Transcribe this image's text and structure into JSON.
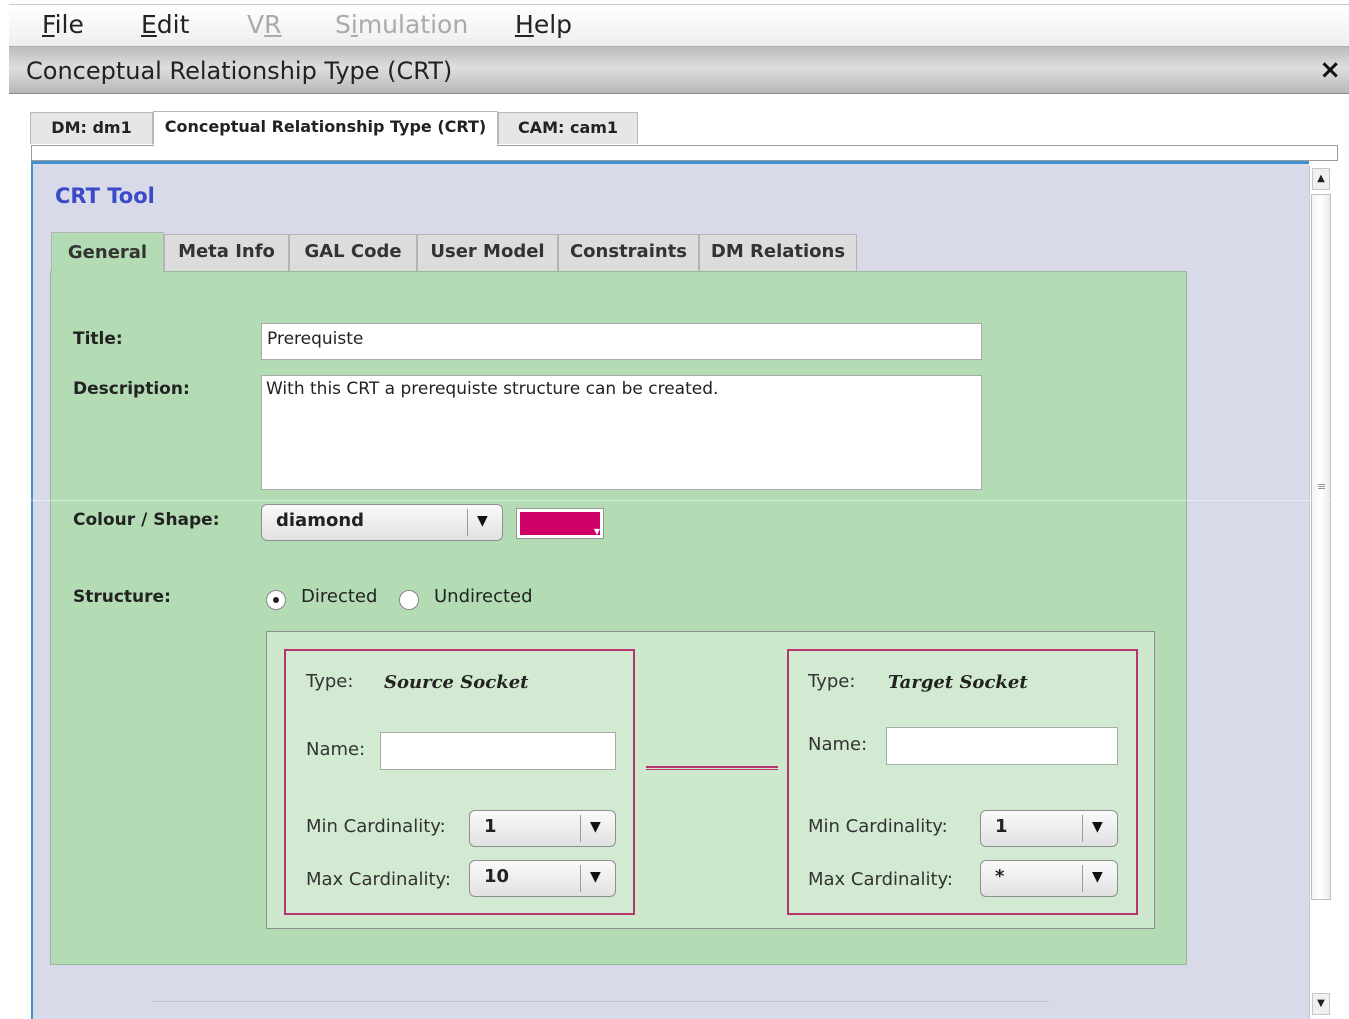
{
  "menu": {
    "items": [
      {
        "label": "File",
        "accel": "F",
        "rest": "ile",
        "enabled": true
      },
      {
        "label": "Edit",
        "accel": "E",
        "rest": "dit",
        "enabled": true
      },
      {
        "label": "VR",
        "accel": "V",
        "rest": "R",
        "enabled": false
      },
      {
        "label": "Simulation",
        "pre": "S",
        "accel": "i",
        "rest": "mulation",
        "enabled": false
      },
      {
        "label": "Help",
        "accel": "H",
        "rest": "elp",
        "enabled": true
      }
    ]
  },
  "window": {
    "title": "Conceptual Relationship Type (CRT)",
    "close_glyph": "×"
  },
  "top_tabs": [
    "DM: dm1",
    "Conceptual Relationship Type (CRT)",
    "CAM: cam1"
  ],
  "tool": {
    "title": "CRT Tool",
    "tabs": [
      "General",
      "Meta Info",
      "GAL Code",
      "User Model",
      "Constraints",
      "DM Relations"
    ],
    "active_tab": "General"
  },
  "form": {
    "title_label": "Title:",
    "title_value": "Prerequiste",
    "description_label": "Description:",
    "description_value": "With this CRT a prerequiste structure can be created.",
    "colour_shape_label": "Colour / Shape:",
    "shape_value": "diamond",
    "colour": "#cc0066",
    "structure_label": "Structure:",
    "structure_options": [
      "Directed",
      "Undirected"
    ],
    "structure_selected": "Directed"
  },
  "sockets": {
    "source": {
      "type_label": "Type:",
      "type_value": "Source Socket",
      "name_label": "Name:",
      "name_value": "",
      "min_label": "Min Cardinality:",
      "min_value": "1",
      "max_label": "Max Cardinality:",
      "max_value": "10"
    },
    "target": {
      "type_label": "Type:",
      "type_value": "Target Socket",
      "name_label": "Name:",
      "name_value": "",
      "min_label": "Min Cardinality:",
      "min_value": "1",
      "max_label": "Max Cardinality:",
      "max_value": "*"
    }
  },
  "icons": {
    "dropdown": "▼",
    "scroll_up": "▲",
    "scroll_down": "▼",
    "grip": "≡"
  },
  "colors": {
    "accent_blue": "#3f8fd1",
    "panel_green": "#b4dcb4",
    "socket_border": "#b8346e",
    "title_blue": "#3a4ac8"
  }
}
